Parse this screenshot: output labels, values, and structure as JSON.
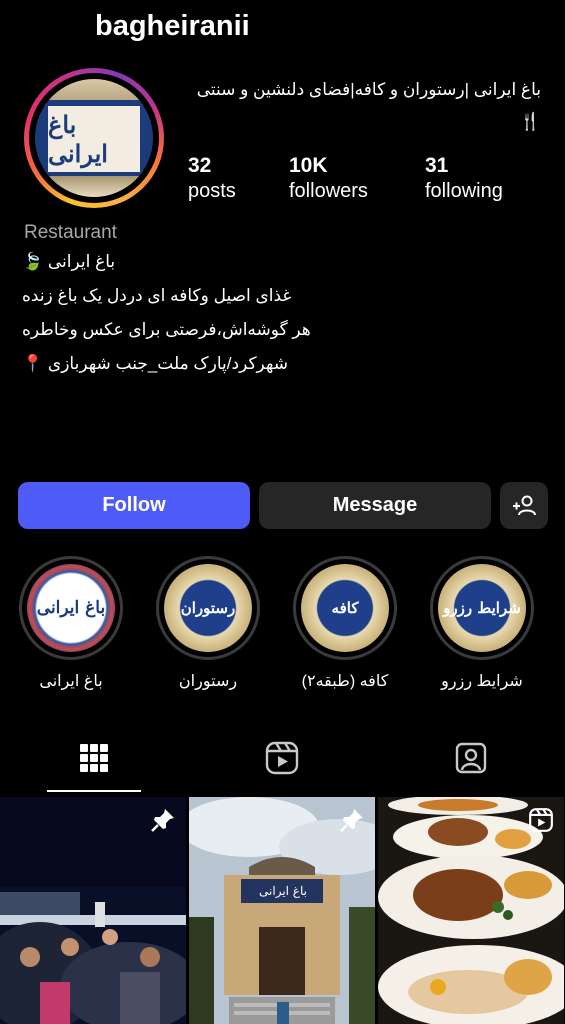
{
  "profile": {
    "username": "bagheiranii",
    "bio_head": "باغ ایرانی |رستوران و کافه|فضای دلنشین و سنتی 🍴",
    "avatar_text": "باغ ایرانی",
    "stats": [
      {
        "value": "32",
        "label": "posts"
      },
      {
        "value": "10K",
        "label": "followers"
      },
      {
        "value": "31",
        "label": "following"
      }
    ],
    "category": "Restaurant",
    "bio_lines": [
      "باغ ایرانی 🍃",
      "غذای اصیل وکافه ای دردل یک باغ زنده",
      "هر گوشه‌اش،فرصتی برای عکس وخاطره",
      "شهرکرد/پارک ملت_جنب شهربازی 📍"
    ]
  },
  "actions": {
    "follow_label": "Follow",
    "message_label": "Message"
  },
  "highlights": [
    {
      "label": "باغ ایرانی",
      "image_text": "باغ ایرانی"
    },
    {
      "label": "رستوران",
      "image_text": "رستوران"
    },
    {
      "label": "کافه (طبقه۲)",
      "image_text": "کافه"
    },
    {
      "label": "شرایط رزرو",
      "image_text": "شرایط رزرو"
    }
  ],
  "tabs": [
    "grid-icon",
    "reels-icon",
    "tagged-icon"
  ],
  "posts": [
    {
      "type": "pinned",
      "icon": "pin-icon"
    },
    {
      "type": "pinned",
      "icon": "pin-icon",
      "sign_text": "باغ ایرانی"
    },
    {
      "type": "reel",
      "icon": "reels-icon"
    }
  ]
}
